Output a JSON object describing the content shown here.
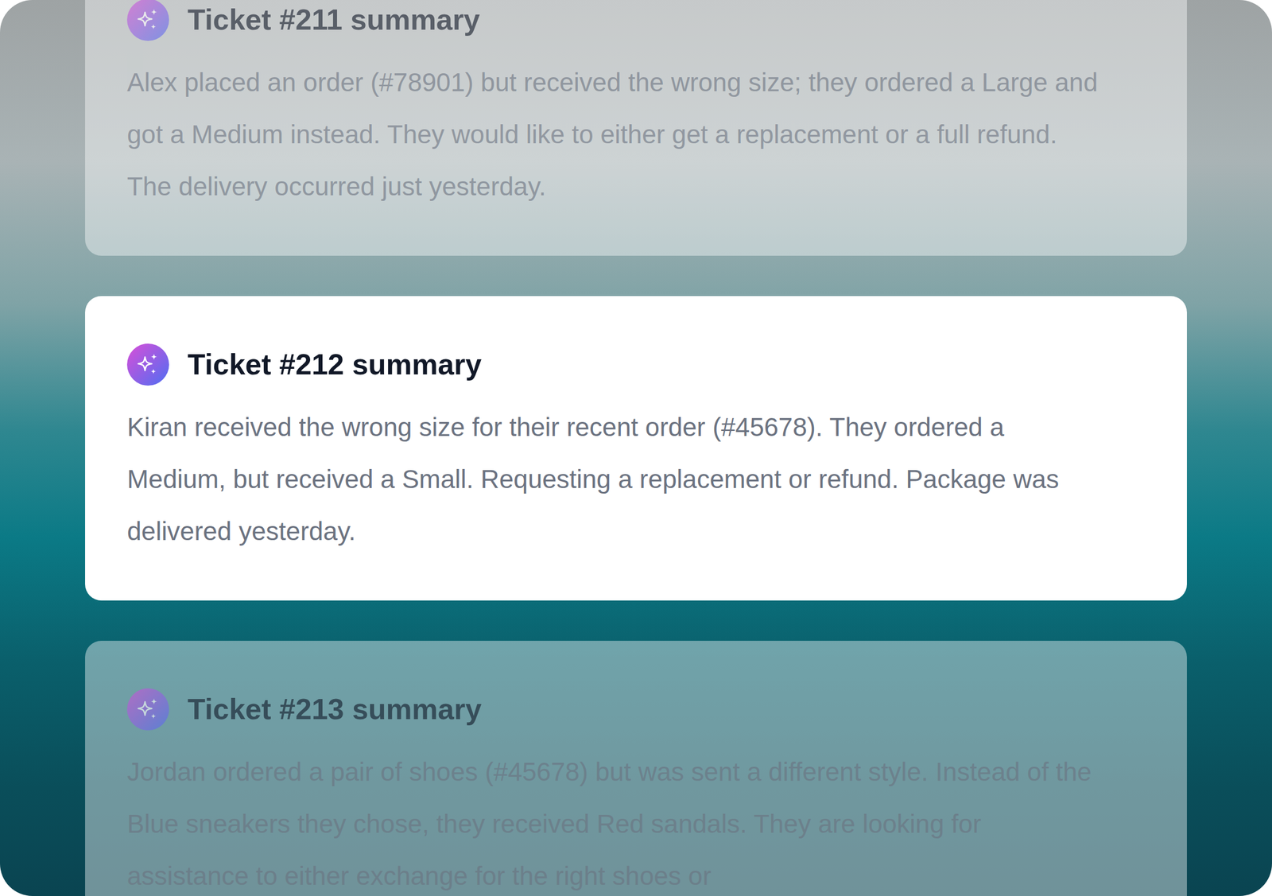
{
  "tickets": [
    {
      "title": "Ticket #211 summary",
      "body": "Alex placed an order (#78901) but received the wrong size; they ordered a Large and got a Medium instead. They would like to either get a replacement or a full refund. The delivery occurred just yesterday.",
      "selected": false
    },
    {
      "title": "Ticket #212 summary",
      "body": "Kiran received the wrong size for their recent order (#45678). They ordered a Medium, but received a Small. Requesting a replacement or refund. Package was delivered yesterday.",
      "selected": true
    },
    {
      "title": "Ticket #213 summary",
      "body": "Jordan ordered a pair of shoes (#45678) but was sent a different style. Instead of the Blue sneakers they chose, they received Red sandals. They are looking for assistance to either exchange for the right shoes or",
      "selected": false
    }
  ]
}
